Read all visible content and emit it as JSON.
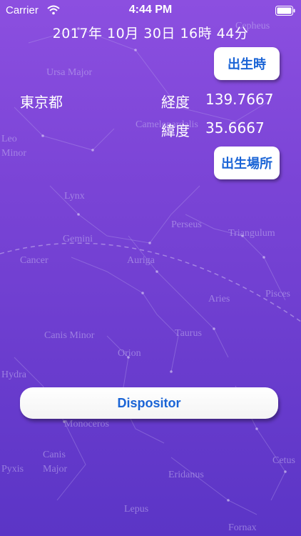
{
  "status_bar": {
    "carrier": "Carrier",
    "time": "4:44 PM"
  },
  "header": {
    "datetime": "2017年 10月 30日 16時 44分"
  },
  "buttons": {
    "birth_time": "出生時",
    "birth_place": "出生場所",
    "dispositor": "Dispositor"
  },
  "location": {
    "name": "東京都",
    "longitude_label": "経度",
    "longitude_value": "139.7667",
    "latitude_label": "緯度",
    "latitude_value": "35.6667"
  },
  "background_labels": [
    "Ursa Major",
    "Camelopardalis",
    "Cepheus",
    "Leo",
    "Minor",
    "Lynx",
    "Perseus",
    "Triangulum",
    "Gemini",
    "Cancer",
    "Auriga",
    "Aries",
    "Pisces",
    "Taurus",
    "Canis Minor",
    "Orion",
    "Hydra",
    "Monoceros",
    "Canis",
    "Major",
    "Pyxis",
    "Eridanus",
    "Cetus",
    "Lepus",
    "Fornax"
  ],
  "colors": {
    "background_top": "#8c4fe0",
    "background_bottom": "#5b35c6",
    "button_text": "#1a64d6",
    "button_bg": "#ffffff"
  }
}
